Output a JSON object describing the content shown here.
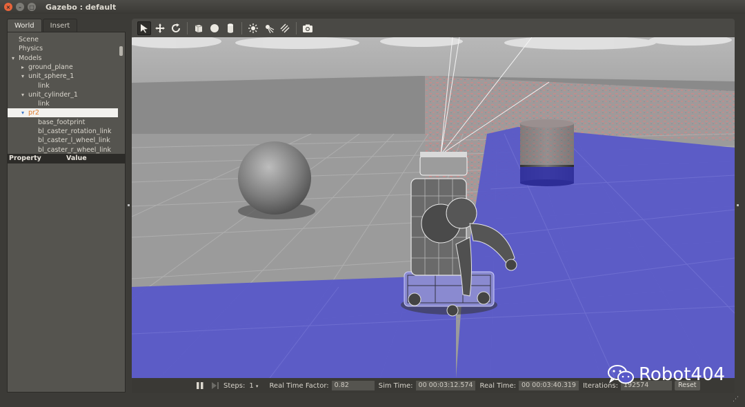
{
  "window": {
    "title": "Gazebo : default"
  },
  "tabs": [
    {
      "label": "World",
      "active": true
    },
    {
      "label": "Insert",
      "active": false
    }
  ],
  "tree": [
    {
      "label": "Scene",
      "indent": 1,
      "expander": ""
    },
    {
      "label": "Physics",
      "indent": 1,
      "expander": ""
    },
    {
      "label": "Models",
      "indent": 1,
      "expander": "▾"
    },
    {
      "label": "ground_plane",
      "indent": 2,
      "expander": "▸"
    },
    {
      "label": "unit_sphere_1",
      "indent": 2,
      "expander": "▾"
    },
    {
      "label": "link",
      "indent": 3,
      "expander": ""
    },
    {
      "label": "unit_cylinder_1",
      "indent": 2,
      "expander": "▾"
    },
    {
      "label": "link",
      "indent": 3,
      "expander": ""
    },
    {
      "label": "pr2",
      "indent": 2,
      "expander": "▾",
      "selected": true
    },
    {
      "label": "base_footprint",
      "indent": 3,
      "expander": ""
    },
    {
      "label": "bl_caster_rotation_link",
      "indent": 3,
      "expander": ""
    },
    {
      "label": "bl_caster_l_wheel_link",
      "indent": 3,
      "expander": ""
    },
    {
      "label": "bl_caster_r_wheel_link",
      "indent": 3,
      "expander": ""
    }
  ],
  "properties": {
    "col_property": "Property",
    "col_value": "Value"
  },
  "toolbar": {
    "tools": [
      "select-arrow-icon",
      "translate-icon",
      "rotate-icon",
      "box-icon",
      "sphere-icon",
      "cylinder-icon",
      "point-light-icon",
      "spot-light-icon",
      "directional-light-icon",
      "camera-icon"
    ]
  },
  "status": {
    "steps_label": "Steps:",
    "steps_value": "1",
    "rtf_label": "Real Time Factor:",
    "rtf_value": "0.82",
    "sim_time_label": "Sim Time:",
    "sim_time_value": "00 00:03:12.574",
    "real_time_label": "Real Time:",
    "real_time_value": "00 00:03:40.319",
    "iterations_label": "Iterations:",
    "iterations_value": "192574",
    "reset_label": "Reset"
  },
  "watermark": {
    "text": "Robot404"
  },
  "colors": {
    "accent": "#e07b2a",
    "close_button": "#e8643a",
    "ground_blue": "#5555c8"
  }
}
